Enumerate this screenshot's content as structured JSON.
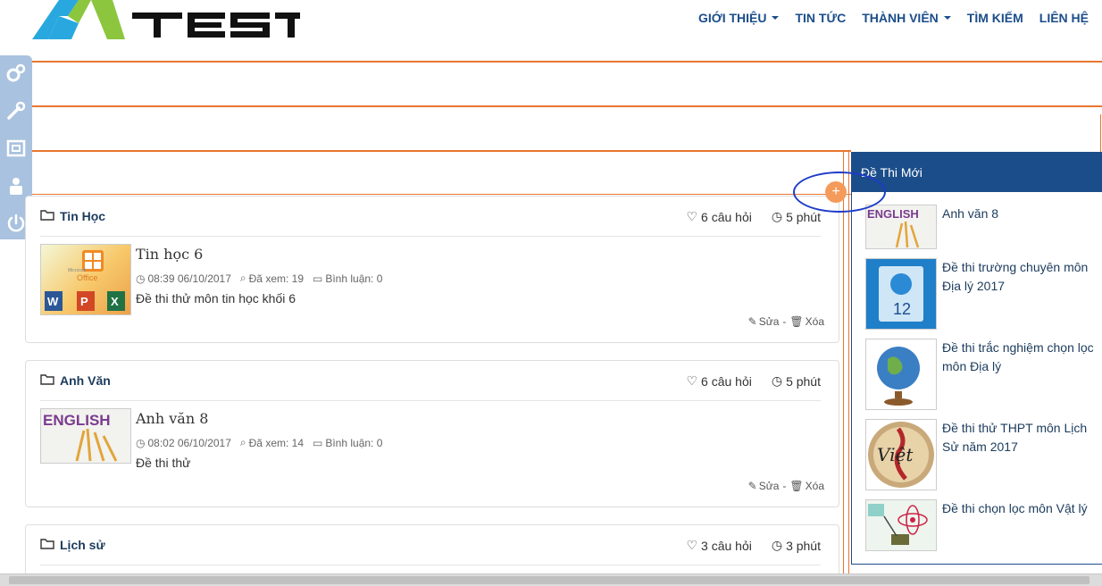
{
  "header": {
    "logo_text": "TEST",
    "nav": [
      {
        "label": "GIỚI THIỆU",
        "dropdown": true
      },
      {
        "label": "TIN TỨC",
        "dropdown": false
      },
      {
        "label": "THÀNH VIÊN",
        "dropdown": true
      },
      {
        "label": "TÌM KIẾM",
        "dropdown": false
      },
      {
        "label": "LIÊN HỆ",
        "dropdown": false
      }
    ]
  },
  "toolstrip": [
    "gears-icon",
    "wrench-icon",
    "frame-icon",
    "user-lock-icon",
    "power-icon"
  ],
  "cards": [
    {
      "category": "Tin Học",
      "questions": "6 câu hỏi",
      "duration": "5 phút",
      "title": "Tin học 6",
      "datetime": "08:39 06/10/2017",
      "views": "Đã xem: 19",
      "comments": "Bình luận: 0",
      "description": "Đề thi thử môn tin học khối 6",
      "thumb_text": "Office",
      "thumb_brand": "Microsoft",
      "edit": "Sửa",
      "delete": "Xóa"
    },
    {
      "category": "Anh Văn",
      "questions": "6 câu hỏi",
      "duration": "5 phút",
      "title": "Anh văn 8",
      "datetime": "08:02 06/10/2017",
      "views": "Đã xem: 14",
      "comments": "Bình luận: 0",
      "description": "Đề thi thử",
      "thumb_text": "ENGLISH",
      "edit": "Sửa",
      "delete": "Xóa"
    },
    {
      "category": "Lịch sử",
      "questions": "3 câu hỏi",
      "duration": "3 phút"
    }
  ],
  "sidebar": {
    "title": "Đề Thi Mới",
    "items": [
      {
        "label": "Anh văn 8",
        "thumb_text": "ENGLISH"
      },
      {
        "label": "Đề thi trường chuyên môn Địa lý 2017",
        "thumb_text": "12"
      },
      {
        "label": "Đề thi trắc nghiệm chọn lọc môn Địa lý"
      },
      {
        "label": "Đề thi thử THPT môn Lịch Sử năm 2017",
        "thumb_text": "Việt"
      },
      {
        "label": "Đề thi chọn lọc môn Vật lý"
      }
    ]
  },
  "add_button_symbol": "+",
  "colors": {
    "brand_blue": "#1b4d8a",
    "orange_line": "#e8762f",
    "annotation_blue": "#1e3cc9"
  }
}
